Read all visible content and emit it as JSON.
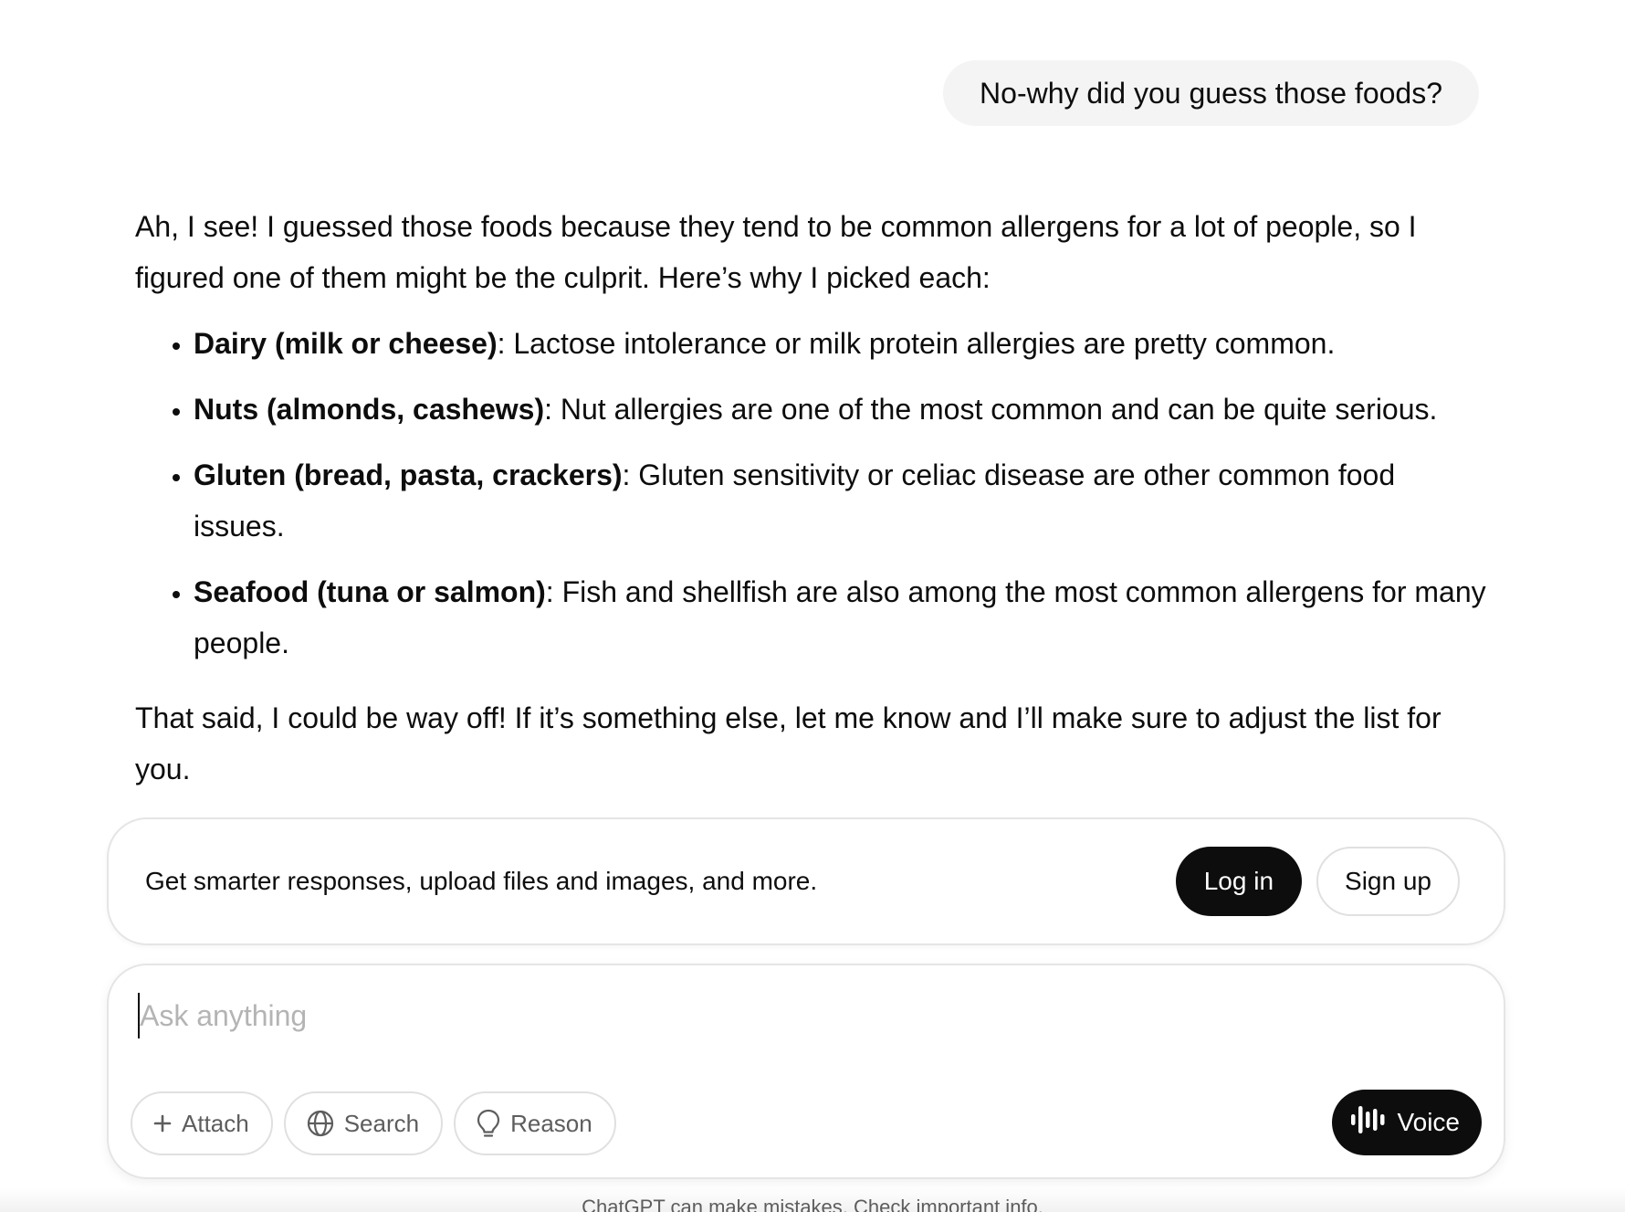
{
  "conversation": {
    "user_message": "No-why did you guess those foods?",
    "assistant": {
      "intro": "Ah, I see! I guessed those foods because they tend to be common allergens for a lot of people, so I figured one of them might be the culprit. Here’s why I picked each:",
      "items": [
        {
          "title": "Dairy (milk or cheese)",
          "text": ": Lactose intolerance or milk protein allergies are pretty common."
        },
        {
          "title": "Nuts (almonds, cashews)",
          "text": ": Nut allergies are one of the most common and can be quite serious."
        },
        {
          "title": "Gluten (bread, pasta, crackers)",
          "text": ": Gluten sensitivity or celiac disease are other common food issues."
        },
        {
          "title": "Seafood (tuna or salmon)",
          "text": ": Fish and shellfish are also among the most common allergens for many people."
        }
      ],
      "outro": "That said, I could be way off! If it’s something else, let me know and I’ll make sure to adjust the list for you."
    }
  },
  "promo": {
    "text": "Get smarter responses, upload files and images, and more.",
    "login_label": "Log in",
    "signup_label": "Sign up"
  },
  "composer": {
    "placeholder": "Ask anything",
    "value": "",
    "tools": [
      {
        "label": "Attach",
        "icon": "plus-icon"
      },
      {
        "label": "Search",
        "icon": "globe-icon"
      },
      {
        "label": "Reason",
        "icon": "lightbulb-icon"
      }
    ],
    "voice_label": "Voice",
    "voice_icon": "waveform-icon"
  },
  "footer": {
    "note": "ChatGPT can make mistakes. Check important info."
  },
  "colors": {
    "accent_dark": "#0d0d0d",
    "bubble_bg": "#f4f4f4",
    "border": "#e5e5e5",
    "placeholder": "#b4b4b4"
  }
}
